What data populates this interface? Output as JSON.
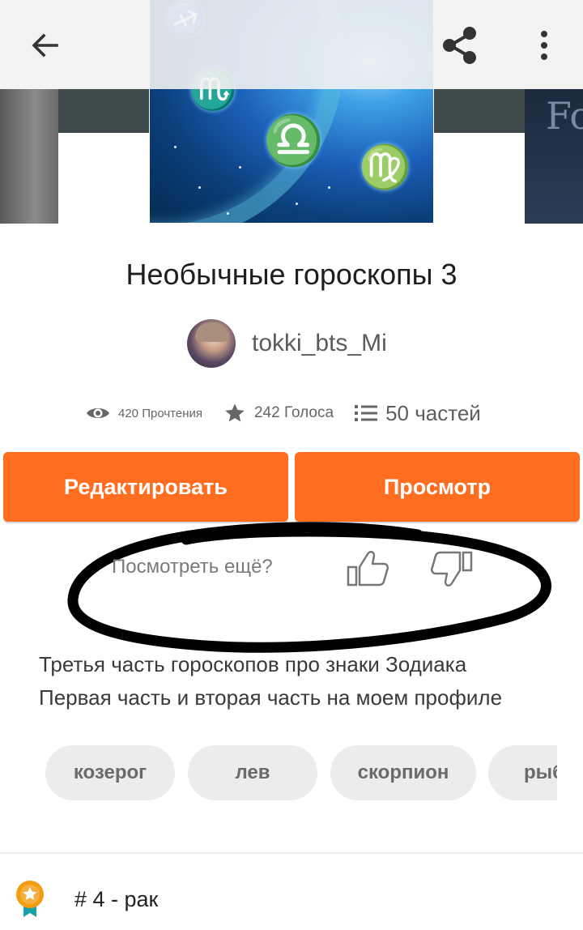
{
  "story": {
    "title": "Необычные гороскопы 3",
    "author": "tokki_bts_Mi",
    "stats": {
      "reads": "420 Прочтения",
      "votes": "242 Голоса",
      "parts": "50 частей"
    }
  },
  "actions": {
    "edit_label": "Редактировать",
    "view_label": "Просмотр"
  },
  "recommendation": {
    "question": "Посмотреть ещё?"
  },
  "description": {
    "line1": "Третья часть  гороскопов про знаки Зодиака",
    "line2": "Первая часть и вторая часть на моем профиле"
  },
  "tags": [
    "козерог",
    "лев",
    "скорпион",
    "рыбы"
  ],
  "ranking": {
    "label": "# 4 - рак"
  },
  "colors": {
    "accent": "#ff6d21",
    "tag_bg": "#ececec"
  },
  "icons": {
    "back": "arrow-left-icon",
    "share": "share-icon",
    "more": "more-vertical-icon",
    "reads": "eye-icon",
    "votes": "star-icon",
    "parts": "list-icon",
    "like": "thumb-up-icon",
    "dislike": "thumb-down-icon",
    "rank": "award-badge-icon"
  }
}
